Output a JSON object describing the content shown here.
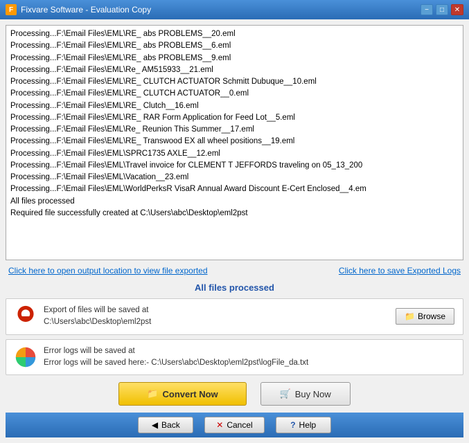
{
  "titleBar": {
    "title": "Fixvare Software - Evaluation Copy",
    "minimizeLabel": "−",
    "maximizeLabel": "□",
    "closeLabel": "✕"
  },
  "logLines": [
    "Processing...F:\\Email Files\\EML\\RE_ abs PROBLEMS__20.eml",
    "Processing...F:\\Email Files\\EML\\RE_ abs PROBLEMS__6.eml",
    "Processing...F:\\Email Files\\EML\\RE_ abs PROBLEMS__9.eml",
    "Processing...F:\\Email Files\\EML\\Re_ AM515933__21.eml",
    "Processing...F:\\Email Files\\EML\\RE_ CLUTCH ACTUATOR Schmitt Dubuque__10.eml",
    "Processing...F:\\Email Files\\EML\\RE_ CLUTCH ACTUATOR__0.eml",
    "Processing...F:\\Email Files\\EML\\RE_ Clutch__16.eml",
    "Processing...F:\\Email Files\\EML\\RE_ RAR Form Application for Feed Lot__5.eml",
    "Processing...F:\\Email Files\\EML\\Re_ Reunion This Summer__17.eml",
    "Processing...F:\\Email Files\\EML\\RE_ Transwood EX all wheel positions__19.eml",
    "Processing...F:\\Email Files\\EML\\SPRC1735 AXLE__12.eml",
    "Processing...F:\\Email Files\\EML\\Travel invoice for CLEMENT T JEFFORDS traveling on 05_13_200",
    "Processing...F:\\Email Files\\EML\\Vacation__23.eml",
    "Processing...F:\\Email Files\\EML\\WorldPerksR VisaR Annual Award Discount E-Cert Enclosed__4.em",
    "All files processed",
    "",
    "Required file successfully created at C:\\Users\\abc\\Desktop\\eml2pst"
  ],
  "links": {
    "openOutput": "Click here to open output location to view file exported",
    "saveLogs": "Click here to save Exported Logs"
  },
  "allFilesProcessed": "All files processed",
  "exportPanel": {
    "label": "Export of files will be saved at",
    "path": "C:\\Users\\abc\\Desktop\\eml2pst",
    "browseLabel": "Browse"
  },
  "errorPanel": {
    "label": "Error logs will be saved at",
    "pathLabel": "Error logs will be saved here:- C:\\Users\\abc\\Desktop\\eml2pst\\logFile_da.txt"
  },
  "buttons": {
    "convert": "Convert Now",
    "buy": "Buy Now",
    "back": "Back",
    "cancel": "Cancel",
    "help": "Help"
  },
  "icons": {
    "folder": "📁",
    "cart": "🛒",
    "back_arrow": "◀",
    "cancel_x": "✕",
    "help_q": "?"
  }
}
